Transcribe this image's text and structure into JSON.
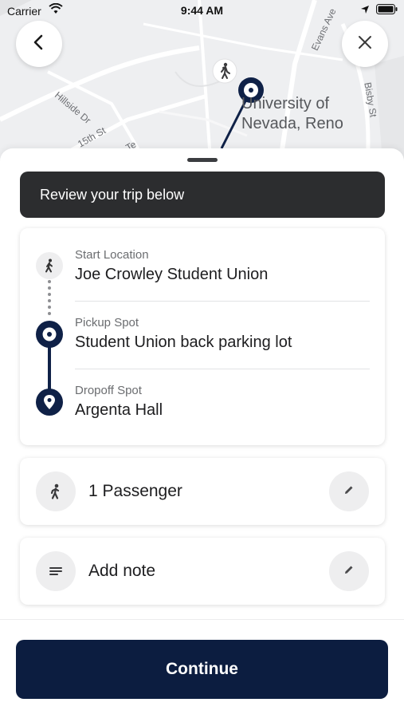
{
  "status_bar": {
    "carrier": "Carrier",
    "time": "9:44 AM",
    "icons": [
      "wifi-icon",
      "location-arrow-icon",
      "battery-icon"
    ]
  },
  "map": {
    "labels": {
      "university": "University of\nNevada, Reno",
      "evans": "Evans Ave",
      "bisby": "Bisby St",
      "hillside": "Hillside Dr",
      "fifteenth": "15th St",
      "partial": "Te"
    }
  },
  "nav": {
    "back_icon": "chevron-left-icon",
    "close_icon": "close-icon"
  },
  "banner": {
    "text": "Review your trip below"
  },
  "trip": {
    "stops": [
      {
        "label": "Start Location",
        "value": "Joe Crowley Student Union",
        "icon": "walking-person-icon"
      },
      {
        "label": "Pickup Spot",
        "value": "Student Union back parking lot",
        "icon": "pickup-target-icon"
      },
      {
        "label": "Dropoff Spot",
        "value": "Argenta Hall",
        "icon": "location-pin-icon"
      }
    ]
  },
  "options": {
    "passengers": {
      "label": "1 Passenger",
      "icon": "person-icon",
      "edit_icon": "pencil-icon"
    },
    "note": {
      "label": "Add note",
      "icon": "notes-icon",
      "edit_icon": "pencil-icon"
    }
  },
  "continue_label": "Continue",
  "colors": {
    "navy": "#0c1d40",
    "banner": "#2c2d2f",
    "route": "#0f2147"
  }
}
